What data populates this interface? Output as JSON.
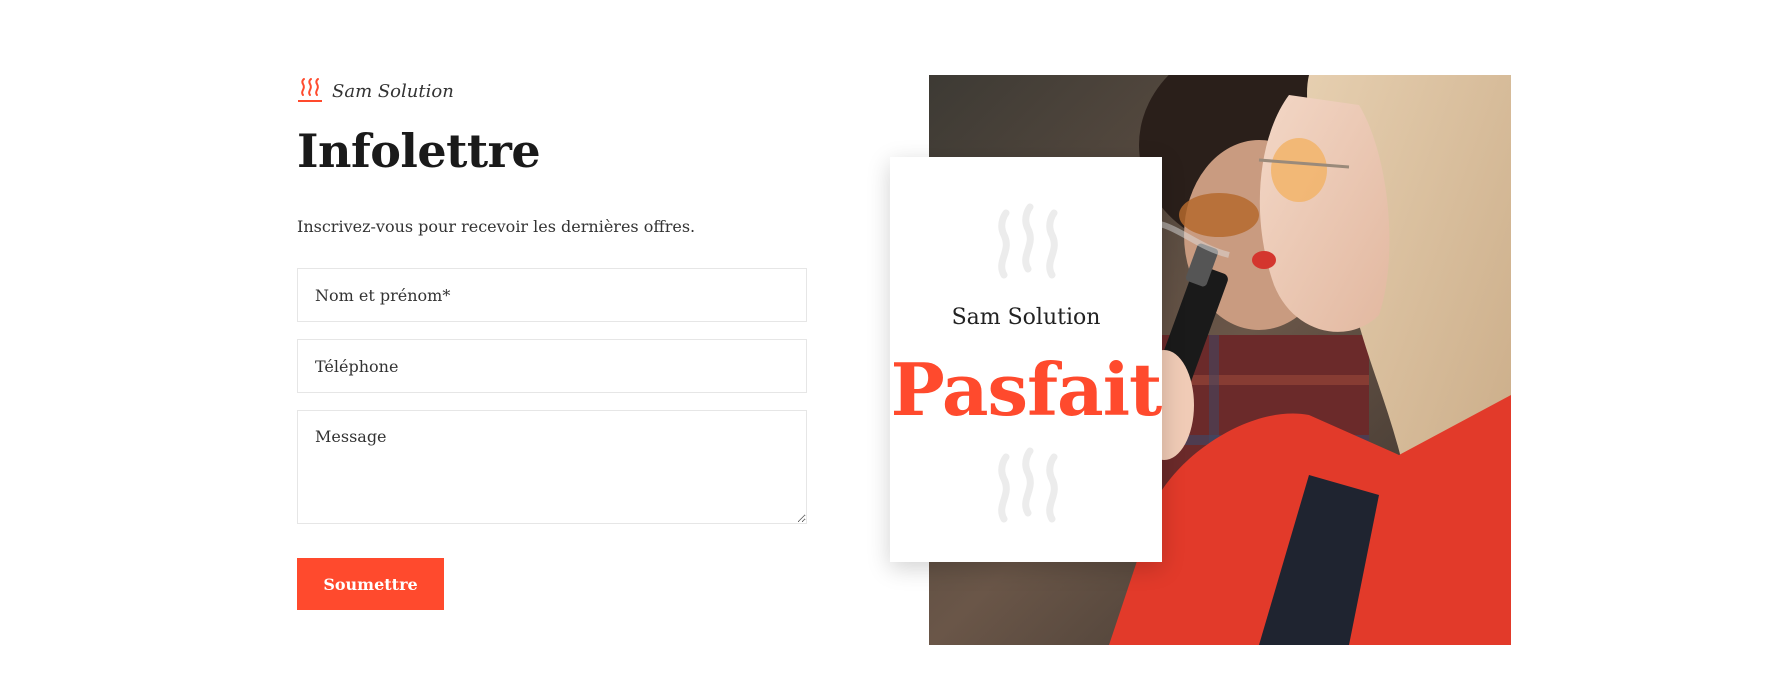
{
  "brand": {
    "name": "Sam Solution",
    "icon": "steam-icon",
    "accent_color": "#ff4a2d"
  },
  "newsletter": {
    "title": "Infolettre",
    "subtitle": "Inscrivez-vous pour recevoir les dernières offres.",
    "fields": {
      "name_placeholder": "Nom et prénom*",
      "phone_placeholder": "Téléphone",
      "message_placeholder": "Message"
    },
    "submit_label": "Soumettre"
  },
  "card": {
    "brand": "Sam Solution",
    "word": "Pasfait",
    "icon": "steam-icon"
  }
}
